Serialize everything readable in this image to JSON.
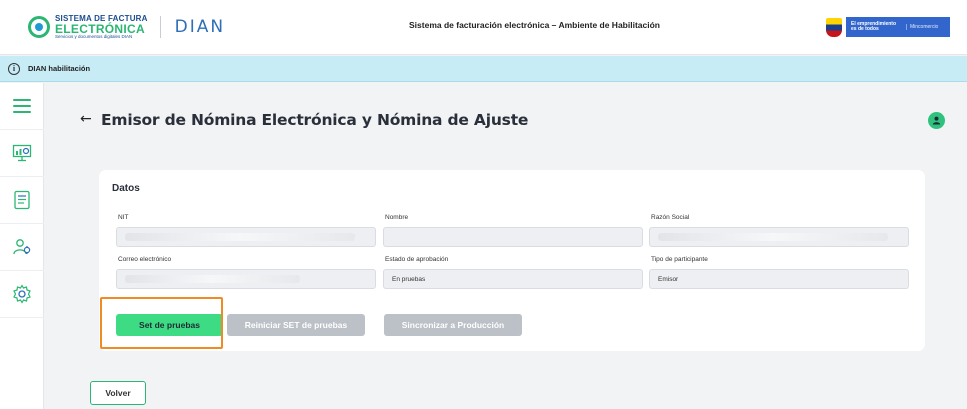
{
  "header": {
    "brand_line1": "SISTEMA DE FACTURA",
    "brand_line2": "ELECTRÓNICA",
    "brand_line3": "Servicios y documentos digitales DIAN",
    "dian_logo": "DIAN",
    "title": "Sistema de facturación electrónica – Ambiente de Habilitación",
    "gov_line1": "El emprendimiento",
    "gov_line2": "es de todos",
    "gov_ministry": "Mincomercio"
  },
  "infobar": {
    "icon": "info-icon",
    "text": "DIAN habilitación"
  },
  "sidebar": {
    "items": [
      {
        "icon": "menu-icon"
      },
      {
        "icon": "dashboard-monitor-icon"
      },
      {
        "icon": "document-list-icon"
      },
      {
        "icon": "users-settings-icon"
      },
      {
        "icon": "gear-icon"
      }
    ]
  },
  "page": {
    "title": "Emisor de Nómina Electrónica y Nómina de Ajuste",
    "back_icon": "back-arrow-icon",
    "avatar_icon": "user-avatar-icon"
  },
  "datos": {
    "title": "Datos",
    "fields": {
      "nit": {
        "label": "NIT",
        "value": ""
      },
      "nombre": {
        "label": "Nombre",
        "value": ""
      },
      "razon_social": {
        "label": "Razón Social",
        "value": ""
      },
      "correo": {
        "label": "Correo electrónico",
        "value": ""
      },
      "estado": {
        "label": "Estado de aprobación",
        "value": "En pruebas"
      },
      "tipo": {
        "label": "Tipo de participante",
        "value": "Emisor"
      }
    }
  },
  "actions": {
    "set_pruebas": "Set de pruebas",
    "reiniciar": "Reiniciar SET de pruebas",
    "sincronizar": "Sincronizar a Producción",
    "volver": "Volver"
  },
  "colors": {
    "accent_green": "#3ddc84",
    "highlight_orange": "#f08a24",
    "disabled_grey": "#bcc0c7",
    "info_bar": "#c7ecf5"
  }
}
